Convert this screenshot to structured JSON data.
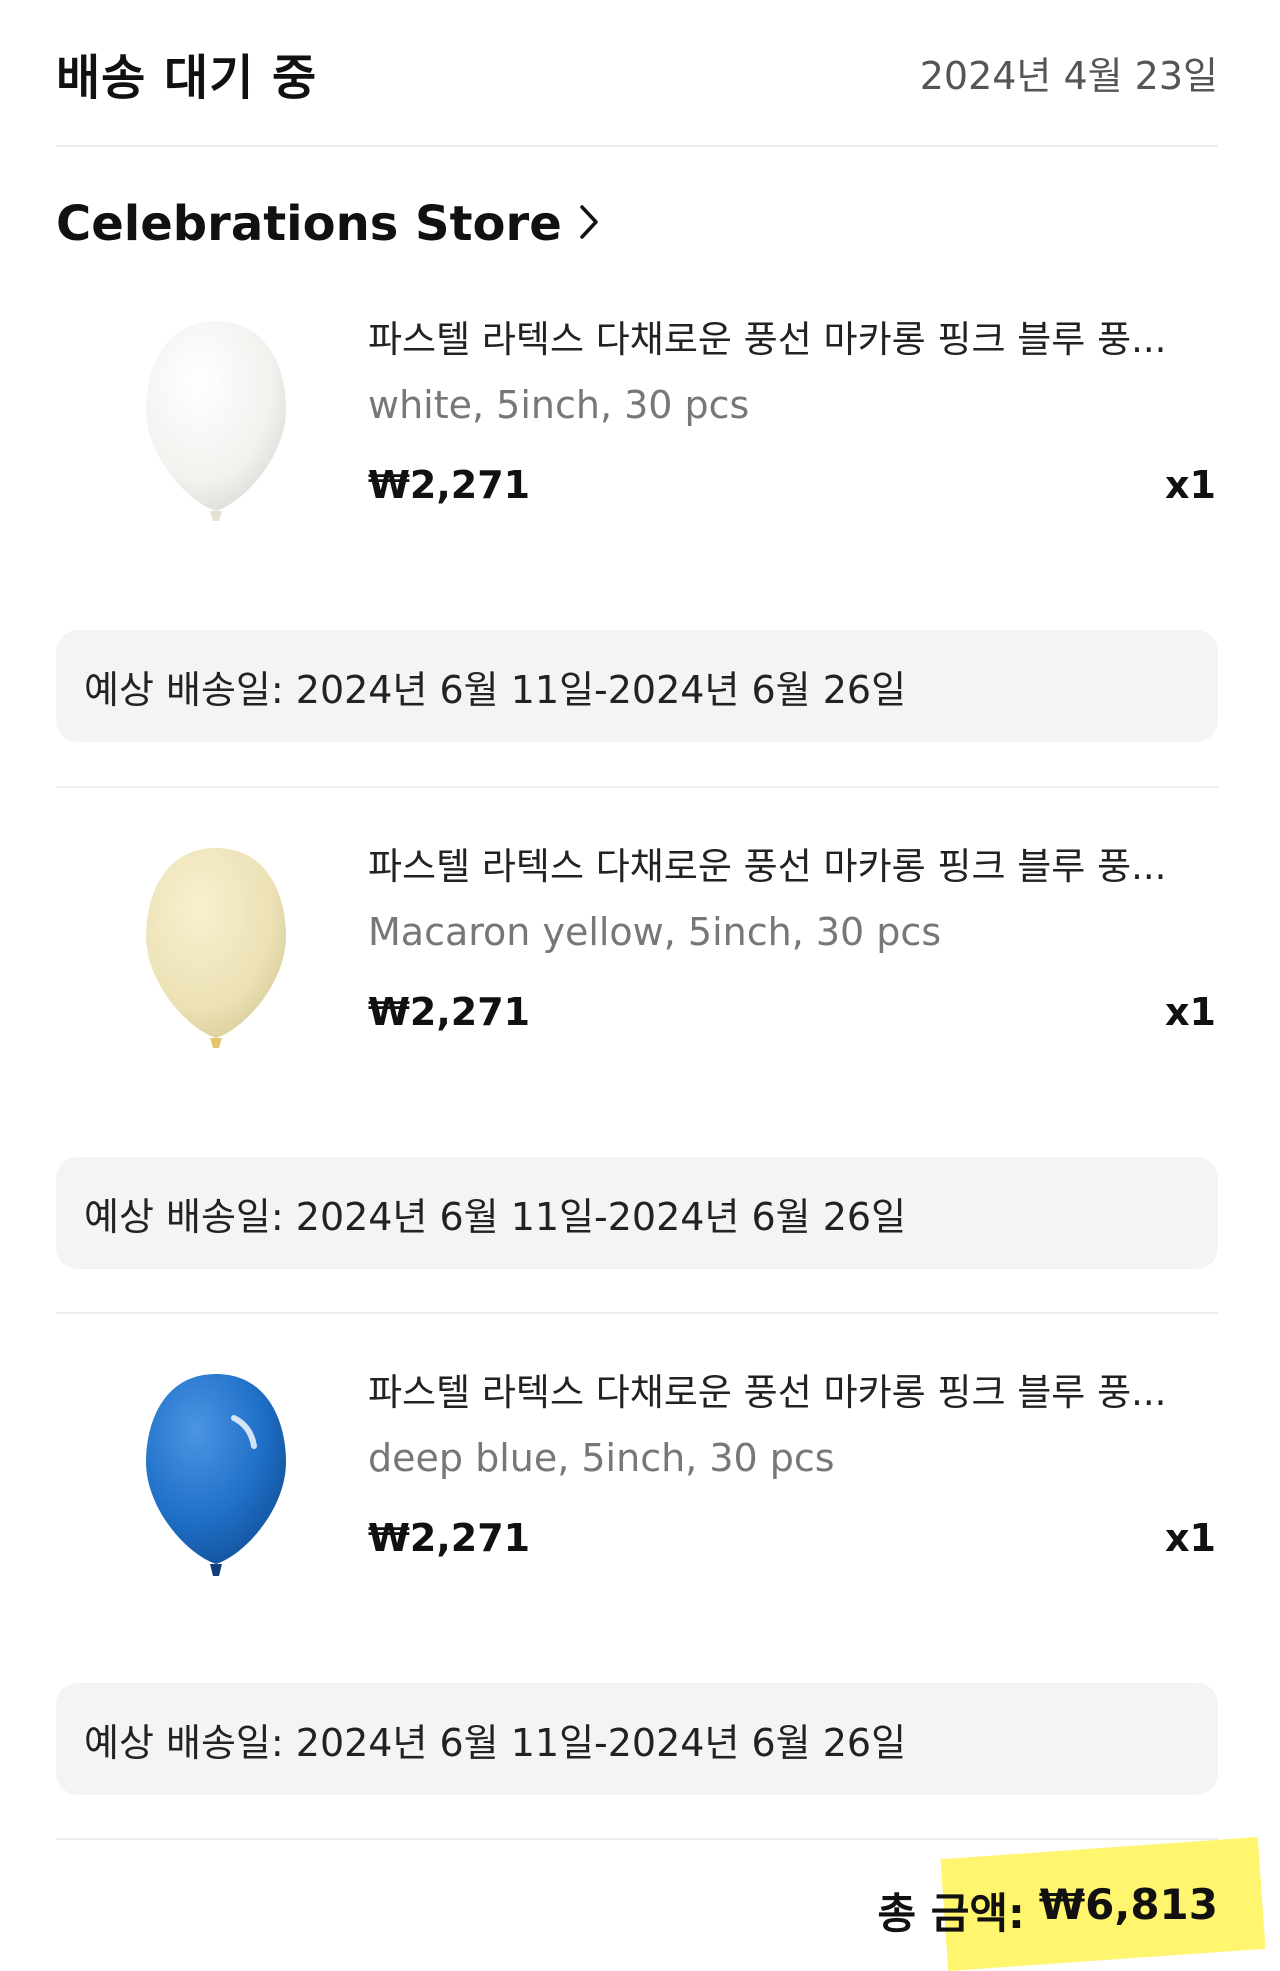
{
  "header": {
    "status": "배송 대기 중",
    "order_date": "2024년 4월 23일"
  },
  "store": {
    "name": "Celebrations Store"
  },
  "items": [
    {
      "title": "파스텔 라텍스 다채로운 풍선 마카롱 핑크 블루 풍...",
      "option": "white, 5inch, 30 pcs",
      "price": "₩2,271",
      "qty": "x1",
      "balloon_color": "#f4f4f2",
      "delivery": "예상 배송일: 2024년 6월 11일-2024년 6월 26일"
    },
    {
      "title": "파스텔 라텍스 다채로운 풍선 마카롱 핑크 블루 풍...",
      "option": "Macaron yellow, 5inch, 30 pcs",
      "price": "₩2,271",
      "qty": "x1",
      "balloon_color": "#efe5bb",
      "delivery": "예상 배송일: 2024년 6월 11일-2024년 6월 26일"
    },
    {
      "title": "파스텔 라텍스 다채로운 풍선 마카롱 핑크 블루 풍...",
      "option": "deep blue, 5inch, 30 pcs",
      "price": "₩2,271",
      "qty": "x1",
      "balloon_color": "#1f70c8",
      "delivery": "예상 배송일: 2024년 6월 11일-2024년 6월 26일"
    }
  ],
  "total": {
    "label": "총 금액:",
    "amount": "₩6,813",
    "highlight_color": "#fff45e"
  }
}
